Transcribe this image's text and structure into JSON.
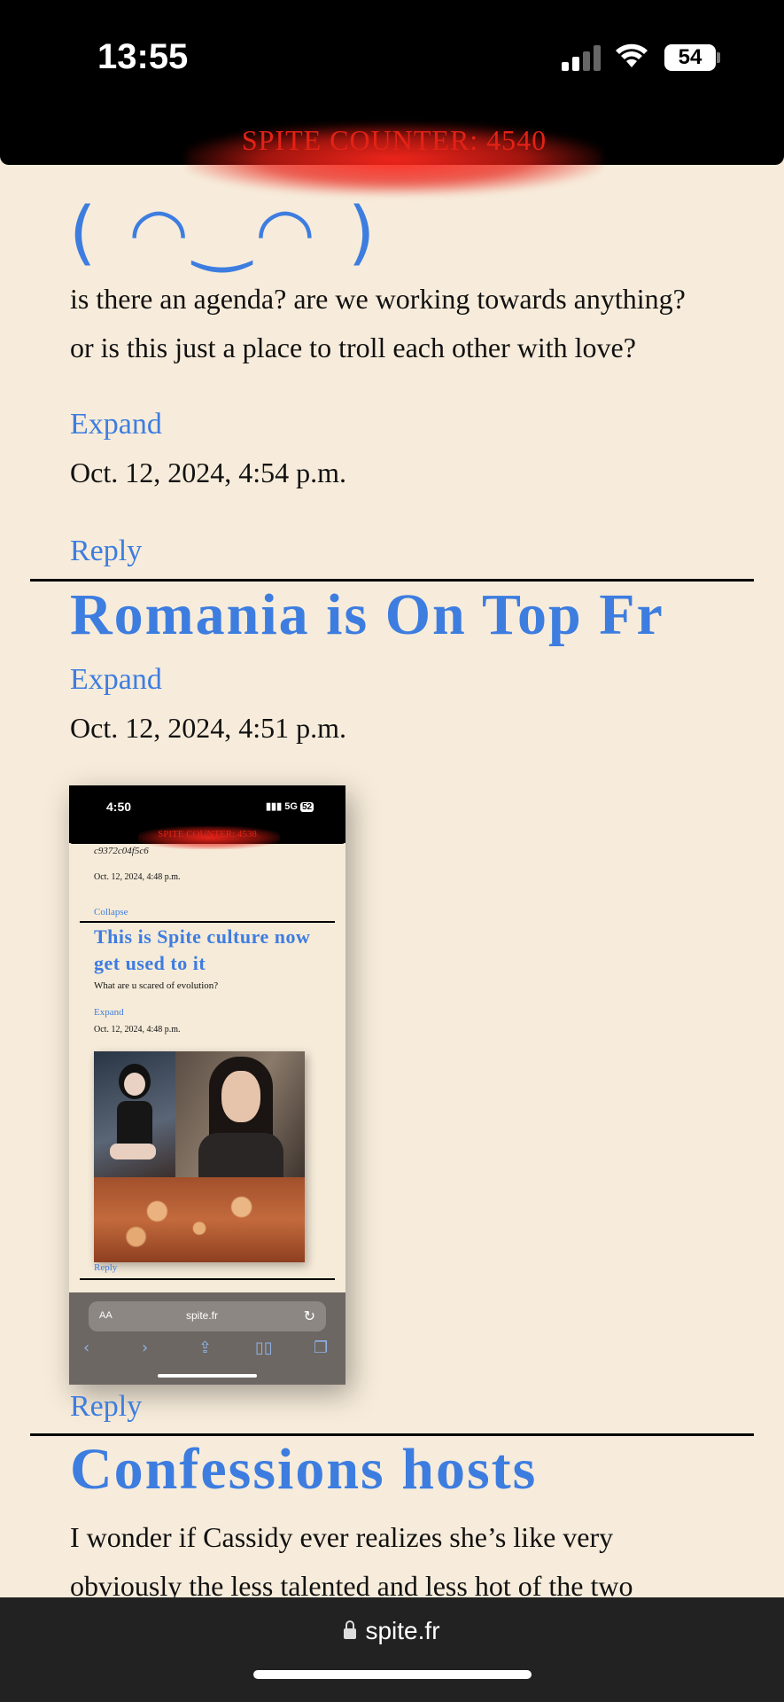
{
  "status_bar": {
    "time": "13:55",
    "battery": "54"
  },
  "spite_counter": "SPITE COUNTER: 4540",
  "post1": {
    "kaomoji": "( ◠‿◠ )",
    "body_line1": "is there an agenda? are we working towards anything?",
    "body_line2": "or is this just a place to troll each other with love?",
    "expand_label": "Expand",
    "date": "Oct. 12, 2024, 4:54 p.m.",
    "reply_label": "Reply"
  },
  "post2": {
    "title": "Romania is On Top Fr",
    "expand_label": "Expand",
    "date": "Oct. 12, 2024, 4:51 p.m.",
    "reply_label": "Reply",
    "screenshot": {
      "time": "4:50",
      "network": "5G",
      "battery": "52",
      "spite_counter": "SPITE COUNTER: 4538",
      "hash": "c9372c04f5c6",
      "date_top": "Oct. 12, 2024, 4:48 p.m.",
      "collapse_label": "Collapse",
      "inner_title": "This is Spite culture now get used to it",
      "inner_body": "What are u scared of evolution?",
      "inner_expand": "Expand",
      "inner_date": "Oct. 12, 2024, 4:48 p.m.",
      "inner_reply": "Reply",
      "url_aa": "AA",
      "url_host": "spite.fr"
    }
  },
  "post3": {
    "title": "Confessions hosts",
    "body_line1": "I wonder if Cassidy ever realizes she’s like very",
    "body_line2": "obviously the less talented and less hot of the two"
  },
  "browser": {
    "url": "spite.fr"
  }
}
